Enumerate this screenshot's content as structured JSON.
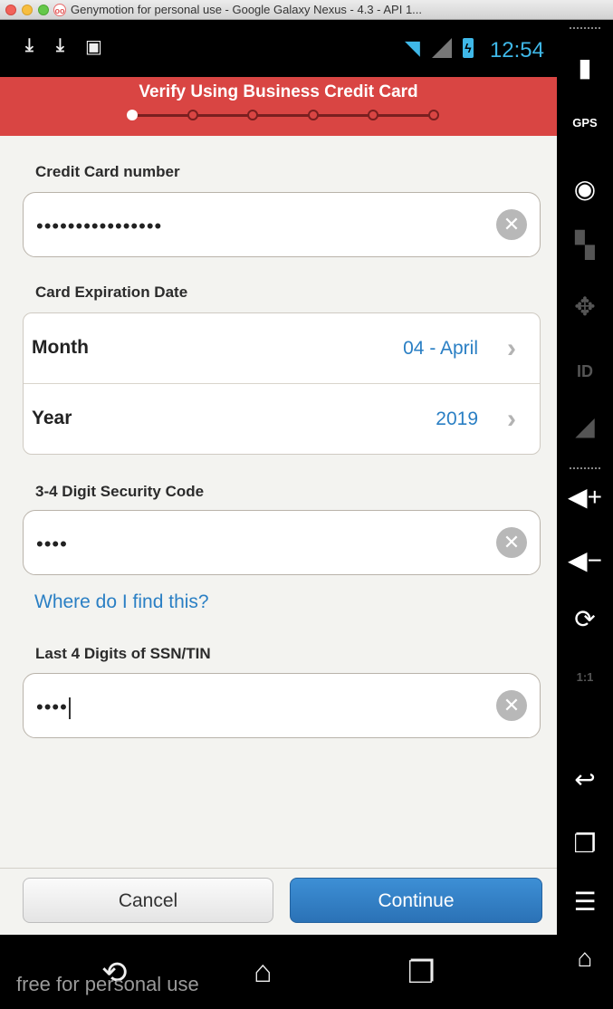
{
  "window": {
    "title": "Genymotion for personal use - Google Galaxy Nexus - 4.3 - API 1...",
    "logo_glyph": "oo"
  },
  "status_bar": {
    "time": "12:54",
    "icons": [
      "download-icon",
      "download-icon",
      "shopping-bag-icon",
      "wifi-icon",
      "signal-icon",
      "battery-charging-icon"
    ],
    "accent_color": "#3fb8e8"
  },
  "header": {
    "title": "Verify Using Business Credit Card",
    "background_color": "#d94543",
    "steps_total": 6,
    "current_step": 1
  },
  "form": {
    "card_number": {
      "label": "Credit Card number",
      "value": "••••••••••••••••"
    },
    "expiration": {
      "label": "Card Expiration Date",
      "month_label": "Month",
      "month_value": "04 - April",
      "year_label": "Year",
      "year_value": "2019"
    },
    "security_code": {
      "label": "3-4 Digit Security Code",
      "value": "••••"
    },
    "help_link": "Where do I find this?",
    "ssn": {
      "label": "Last 4 Digits of SSN/TIN",
      "value": "••••"
    }
  },
  "buttons": {
    "cancel": "Cancel",
    "continue": "Continue",
    "continue_color": "#2b72b6"
  },
  "watermark": "free for personal use",
  "sidebar": {
    "gps_label": "GPS",
    "id_label": "ID",
    "ratio_label": "1:1"
  },
  "link_color": "#2a7fc4"
}
